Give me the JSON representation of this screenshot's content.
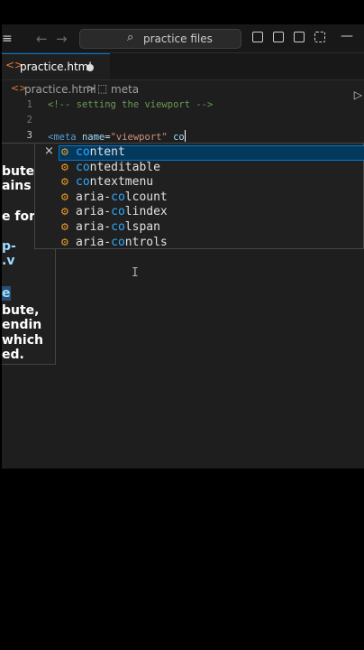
{
  "titlebar": {
    "menu_icon": "hamburger-menu-icon",
    "back_icon": "arrow-left-icon",
    "forward_icon": "arrow-right-icon",
    "search_placeholder": "practice files",
    "layout_icons": [
      "toggle-primary-sidebar-icon",
      "toggle-panel-icon",
      "toggle-secondary-sidebar-icon",
      "customize-layout-icon",
      "minimize-icon"
    ]
  },
  "tab": {
    "filename": "practice.html",
    "modified": true,
    "icon": "html-file-icon"
  },
  "breadcrumb": {
    "file": "practice.html",
    "separator": ">",
    "symbol": "meta"
  },
  "code": {
    "lines": [
      {
        "number": "1",
        "comment": "<!-- setting the viewport -->"
      },
      {
        "number": "2"
      },
      {
        "number": "3",
        "tag_open": "<meta",
        "attr_name": "name",
        "eq": "=",
        "attr_value": "\"viewport\"",
        "typed": "co"
      }
    ]
  },
  "hover_doc": {
    "fragments": [
      "bute",
      "ains",
      "",
      "e for",
      "",
      "p-",
      ".v",
      "",
      "e",
      "bute,",
      "endin",
      "which",
      "ed."
    ]
  },
  "suggestions": {
    "close_label": "×",
    "selected_index": 0,
    "items": [
      {
        "match": "co",
        "rest": "ntent"
      },
      {
        "match": "co",
        "rest": "nteditable"
      },
      {
        "match": "co",
        "rest": "ntextmenu"
      },
      {
        "match": "aria-",
        "mid": "co",
        "rest": "lcount"
      },
      {
        "match": "aria-",
        "mid": "co",
        "rest": "lindex"
      },
      {
        "match": "aria-",
        "mid": "co",
        "rest": "lspan"
      },
      {
        "match": "aria-",
        "mid": "co",
        "rest": "ntrols"
      }
    ]
  },
  "colors": {
    "editor_bg": "#1e1e1e",
    "accent": "#0078d4",
    "comment": "#6a9955",
    "tag": "#569cd6",
    "attribute": "#9cdcfe",
    "string": "#ce9178"
  }
}
